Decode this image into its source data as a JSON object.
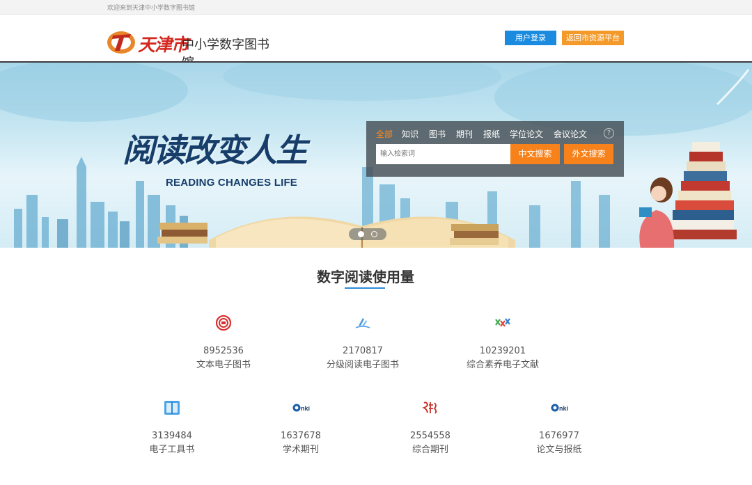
{
  "topbar": {
    "welcome": "欢迎来到天津中小学数字图书馆"
  },
  "header": {
    "logo_city": "天津市",
    "logo_name": "中小学数字图书馆",
    "login_label": "用户登录",
    "back_label": "返回市资源平台"
  },
  "banner": {
    "slogan_cn": "阅读改变人生",
    "slogan_en": "READING CHANGES LIFE"
  },
  "search": {
    "tabs": [
      "全部",
      "知识",
      "图书",
      "期刊",
      "报纸",
      "学位论文",
      "会议论文"
    ],
    "active_tab": "全部",
    "help_glyph": "?",
    "placeholder": "输入检索词",
    "cn_button": "中文搜索",
    "en_button": "外文搜索"
  },
  "section": {
    "title": "数字阅读使用量"
  },
  "stats": [
    {
      "icon": "text-ebook-icon",
      "value": "8952536",
      "label": "文本电子图书"
    },
    {
      "icon": "graded-reading-icon",
      "value": "2170817",
      "label": "分级阅读电子图书"
    },
    {
      "icon": "literacy-docs-icon",
      "value": "10239201",
      "label": "综合素养电子文献"
    },
    {
      "icon": "reference-book-icon",
      "value": "3139484",
      "label": "电子工具书"
    },
    {
      "icon": "cnki-logo-icon",
      "value": "1637678",
      "label": "学术期刊"
    },
    {
      "icon": "longyuan-logo-icon",
      "value": "2554558",
      "label": "综合期刊"
    },
    {
      "icon": "cnki-logo-icon",
      "value": "1676977",
      "label": "论文与报纸"
    }
  ],
  "colors": {
    "accent_blue": "#1b8be0",
    "accent_orange": "#f7821b",
    "active_tab": "#ff8a1e",
    "logo_red": "#d3261d"
  }
}
